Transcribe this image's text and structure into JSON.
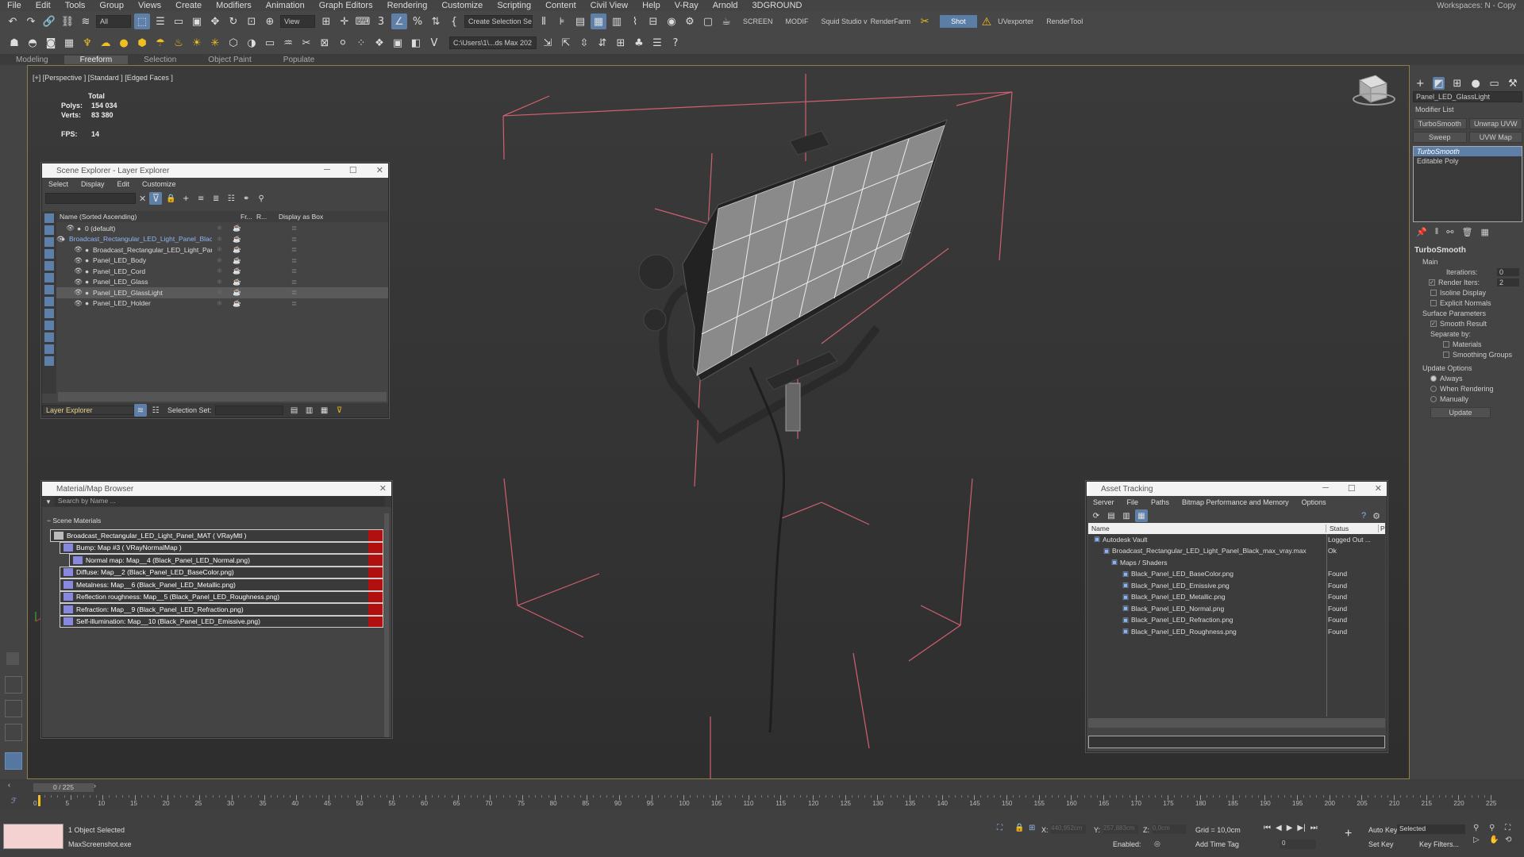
{
  "menu": [
    "File",
    "Edit",
    "Tools",
    "Group",
    "Views",
    "Create",
    "Modifiers",
    "Animation",
    "Graph Editors",
    "Rendering",
    "Customize",
    "Scripting",
    "Content",
    "Civil View",
    "Help",
    "V-Ray",
    "Arnold",
    "3DGROUND"
  ],
  "workspaces": "Workspaces: N - Copy",
  "toolbar": {
    "filter": "All",
    "view": "View",
    "selset": "Create Selection Se",
    "screen": "SCREEN",
    "modif": "MODIF",
    "squid": "Squid Studio v",
    "renderfarm": "RenderFarm",
    "shot": "Shot",
    "uvexporter": "UVexporter",
    "rendertool": "RenderTool",
    "path": "C:\\Users\\1\\...ds Max 202"
  },
  "ribbon": [
    "Modeling",
    "Freeform",
    "Selection",
    "Object Paint",
    "Populate"
  ],
  "viewport": {
    "label": "[+] [Perspective ] [Standard ] [Edged Faces ]",
    "total": "Total",
    "polys_k": "Polys:",
    "polys": "154 034",
    "verts_k": "Verts:",
    "verts": "83 380",
    "fps_k": "FPS:",
    "fps": "14"
  },
  "scene_explorer": {
    "title": "Scene Explorer - Layer Explorer",
    "menu": [
      "Select",
      "Display",
      "Edit",
      "Customize"
    ],
    "col_name": "Name (Sorted Ascending)",
    "col_fr": "Fr...",
    "col_r": "R...",
    "col_box": "Display as Box",
    "rows": [
      "0 (default)",
      "Broadcast_Rectangular_LED_Light_Panel_Black",
      "Broadcast_Rectangular_LED_Light_Panel_Black",
      "Panel_LED_Body",
      "Panel_LED_Cord",
      "Panel_LED_Glass",
      "Panel_LED_GlassLight",
      "Panel_LED_Holder"
    ],
    "footer_left": "Layer Explorer",
    "selset_label": "Selection Set:"
  },
  "material_browser": {
    "title": "Material/Map Browser",
    "search": "Search by Name ...",
    "section": "Scene Materials",
    "rows": [
      "Broadcast_Rectangular_LED_Light_Panel_MAT ( VRayMtl )",
      "Bump: Map #3 ( VRayNormalMap )",
      "Normal map: Map__4 (Black_Panel_LED_Normal.png)",
      "Diffuse: Map__2 (Black_Panel_LED_BaseColor.png)",
      "Metalness: Map__6 (Black_Panel_LED_Metallic.png)",
      "Reflection roughness: Map__5 (Black_Panel_LED_Roughness.png)",
      "Refraction: Map__9 (Black_Panel_LED_Refraction.png)",
      "Self-illumination: Map__10 (Black_Panel_LED_Emissive.png)"
    ]
  },
  "asset_tracking": {
    "title": "Asset Tracking",
    "menu": [
      "Server",
      "File",
      "Paths",
      "Bitmap Performance and Memory",
      "Options"
    ],
    "col_name": "Name",
    "col_status": "Status",
    "col_p": "P",
    "rows": [
      {
        "name": "Autodesk Vault",
        "status": "Logged Out ..."
      },
      {
        "name": "Broadcast_Rectangular_LED_Light_Panel_Black_max_vray.max",
        "status": "Ok"
      },
      {
        "name": "Maps / Shaders",
        "status": ""
      },
      {
        "name": "Black_Panel_LED_BaseColor.png",
        "status": "Found"
      },
      {
        "name": "Black_Panel_LED_Emissive.png",
        "status": "Found"
      },
      {
        "name": "Black_Panel_LED_Metallic.png",
        "status": "Found"
      },
      {
        "name": "Black_Panel_LED_Normal.png",
        "status": "Found"
      },
      {
        "name": "Black_Panel_LED_Refraction.png",
        "status": "Found"
      },
      {
        "name": "Black_Panel_LED_Roughness.png",
        "status": "Found"
      }
    ]
  },
  "cmd": {
    "objname": "Panel_LED_GlassLight",
    "modlist": "Modifier List",
    "btn1": "TurboSmooth",
    "btn2": "Unwrap UVW",
    "btn3": "Sweep",
    "btn4": "UVW Map",
    "stack": [
      "TurboSmooth",
      "Editable Poly"
    ],
    "ts_title": "TurboSmooth",
    "main": "Main",
    "iterations_k": "Iterations:",
    "iterations": "0",
    "render_iters_k": "Render Iters:",
    "render_iters": "2",
    "isoline": "Isoline Display",
    "explicit": "Explicit Normals",
    "surface": "Surface Parameters",
    "smooth": "Smooth Result",
    "separate": "Separate by:",
    "materials": "Materials",
    "smoothing": "Smoothing Groups",
    "update_opts": "Update Options",
    "always": "Always",
    "when_rendering": "When Rendering",
    "manually": "Manually",
    "update": "Update"
  },
  "timeline": {
    "counter": "0 / 225",
    "ticks": [
      "0",
      "5",
      "10",
      "15",
      "20",
      "25",
      "30",
      "35",
      "40",
      "45",
      "50",
      "55",
      "60",
      "65",
      "70",
      "75",
      "80",
      "85",
      "90",
      "95",
      "100",
      "105",
      "110",
      "115",
      "120",
      "125",
      "130",
      "135",
      "140",
      "145",
      "150",
      "155",
      "160",
      "165",
      "170",
      "175",
      "180",
      "185",
      "190",
      "195",
      "200",
      "205",
      "210",
      "215",
      "220",
      "225"
    ]
  },
  "status": {
    "selected": "1 Object Selected",
    "script": "MaxScreenshot.exe",
    "x_k": "X:",
    "x": "440,952cm",
    "y_k": "Y:",
    "y": "257,883cm",
    "z_k": "Z:",
    "z": "0,0cm",
    "grid": "Grid = 10,0cm",
    "autokey": "Auto Key",
    "setkey": "Set Key",
    "sel_dd": "Selected",
    "keyfilters": "Key Filters...",
    "enabled": "Enabled:",
    "addtime": "Add Time Tag",
    "frame": "0"
  }
}
